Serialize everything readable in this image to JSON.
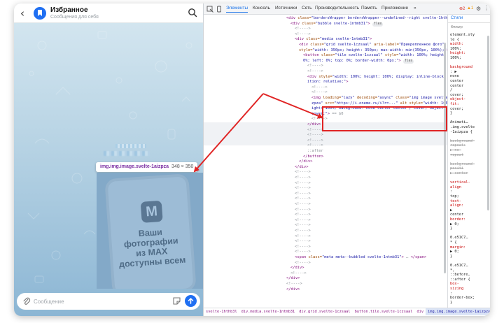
{
  "chat": {
    "back_icon": "arrow-left-icon",
    "title": "Избранное",
    "subtitle": "Сообщения для себя",
    "avatar_icon": "bookmark-icon",
    "search_icon": "search-icon",
    "tooltip": {
      "selector": "img.img.image.svelte-1aizpza",
      "size": "348 × 350"
    },
    "photo": {
      "logo": "M",
      "caption": [
        "Ваши",
        "фотографии",
        "из MAX",
        "доступны всем"
      ]
    },
    "composer": {
      "placeholder": "Сообщение",
      "attach_icon": "paperclip-icon",
      "sticker_icon": "sticker-icon",
      "send_icon": "send-arrow-icon"
    }
  },
  "devtools": {
    "tabs": [
      "Элементы",
      "Консоль",
      "Источники",
      "Сеть",
      "Производительность",
      "Память",
      "Приложение"
    ],
    "active_tab": "Элементы",
    "errors": "2",
    "warnings": "1",
    "more_tabs": "»",
    "code_lines": [
      {
        "indent": 0,
        "parts": [
          [
            "c-tag",
            "<div "
          ],
          [
            "c-attr",
            "class="
          ],
          [
            "c-val",
            "\"bordersWrapper bordersWrapper--undefined--right svelte-1hthb3l\""
          ],
          [
            "c-tag",
            ">"
          ],
          [
            "c-pill",
            "flex"
          ]
        ]
      },
      {
        "indent": 1,
        "parts": [
          [
            "c-tag",
            "<div "
          ],
          [
            "c-attr",
            "class="
          ],
          [
            "c-val",
            "\"bubble svelte-1ntmb31\""
          ],
          [
            "c-tag",
            "> "
          ],
          [
            "c-pill",
            "flex"
          ]
        ]
      },
      {
        "indent": 2,
        "parts": [
          [
            "c-dim",
            "<!---->"
          ]
        ]
      },
      {
        "indent": 2,
        "parts": [
          [
            "c-dim",
            "<!---->"
          ]
        ]
      },
      {
        "indent": 2,
        "parts": [
          [
            "c-tag",
            "<div "
          ],
          [
            "c-attr",
            "class="
          ],
          [
            "c-val",
            "\"media svelte-1ntmb31\""
          ],
          [
            "c-tag",
            ">"
          ]
        ]
      },
      {
        "indent": 3,
        "parts": [
          [
            "c-tag",
            "<div "
          ],
          [
            "c-attr",
            "class="
          ],
          [
            "c-val",
            "\"grid svelte-1czsaal\" "
          ],
          [
            "c-attr",
            "aria-label="
          ],
          [
            "c-val",
            "\"Прикрепленное фото\""
          ]
        ]
      },
      {
        "indent": 3,
        "parts": [
          [
            "c-attr",
            "style="
          ],
          [
            "c-val",
            "\"width: 350px; height: 350px; max-width: min(350px, 100%);\""
          ],
          [
            "c-tag",
            "> "
          ],
          [
            "c-pill",
            "grid"
          ]
        ]
      },
      {
        "indent": 4,
        "parts": [
          [
            "c-tag",
            "<button "
          ],
          [
            "c-attr",
            "class="
          ],
          [
            "c-val",
            "\"tile svelte-1czsaal\" "
          ],
          [
            "c-attr",
            "style="
          ],
          [
            "c-val",
            "\"width: 100%; height: 10"
          ]
        ]
      },
      {
        "indent": 4,
        "parts": [
          [
            "c-val",
            "0%; left: 0%; top: 0%; border-width: 0px;\""
          ],
          [
            "c-tag",
            "> "
          ],
          [
            "c-pill",
            "flex"
          ]
        ]
      },
      {
        "indent": 5,
        "parts": [
          [
            "c-dim",
            "<!---->"
          ]
        ]
      },
      {
        "indent": 5,
        "parts": [
          [
            "c-dim",
            "<!---->"
          ]
        ]
      },
      {
        "indent": 5,
        "parts": [
          [
            "c-tag",
            "<div "
          ],
          [
            "c-attr",
            "style="
          ],
          [
            "c-val",
            "\"width: 100%; height: 100%; display: inline-block; pos"
          ]
        ]
      },
      {
        "indent": 5,
        "parts": [
          [
            "c-val",
            "ition: relative;\""
          ],
          [
            "c-tag",
            ">"
          ]
        ]
      },
      {
        "indent": 6,
        "parts": [
          [
            "c-dim",
            "<!---->"
          ]
        ]
      },
      {
        "indent": 6,
        "parts": [
          [
            "c-dim",
            "<!---->"
          ]
        ]
      },
      {
        "indent": 6,
        "parts": [
          [
            "c-tag",
            "<img "
          ],
          [
            "c-attr",
            "loading="
          ],
          [
            "c-val",
            "\"lazy\" "
          ],
          [
            "c-attr",
            "decoding="
          ],
          [
            "c-val",
            "\"async\" "
          ],
          [
            "c-attr",
            "class="
          ],
          [
            "c-val",
            "\"img image svelte-1ai"
          ]
        ]
      },
      {
        "indent": 6,
        "parts": [
          [
            "c-val",
            "zpza\" "
          ],
          [
            "c-attr",
            "src="
          ],
          [
            "c-val",
            "\"https://i.oneme.ru/i?r=...\" "
          ],
          [
            "c-attr",
            "alt style="
          ],
          [
            "c-val",
            "\"width: 100%; he"
          ]
        ]
      },
      {
        "indent": 6,
        "parts": [
          [
            "c-val",
            "ight: 100%; background: none center center / cover; object-fit:"
          ]
        ]
      },
      {
        "indent": 6,
        "parts": [
          [
            "c-val",
            "cover;\""
          ],
          [
            "c-tag",
            "> "
          ],
          [
            "c-dim",
            "== $0"
          ]
        ]
      },
      {
        "indent": 6,
        "parts": [
          [
            "c-dim",
            "<!---->"
          ]
        ]
      },
      {
        "indent": 5,
        "parts": [
          [
            "c-tag",
            "</div>"
          ]
        ]
      },
      {
        "indent": 5,
        "parts": [
          [
            "c-dim",
            "<!---->"
          ]
        ]
      },
      {
        "indent": 5,
        "parts": [
          [
            "c-dim",
            "<!---->"
          ]
        ]
      },
      {
        "indent": 5,
        "parts": [
          [
            "c-dim",
            "<!---->"
          ]
        ]
      },
      {
        "indent": 5,
        "parts": [
          [
            "c-dim",
            "<!---->"
          ]
        ]
      },
      {
        "indent": 5,
        "parts": [
          [
            "c-dim",
            "::after"
          ]
        ]
      },
      {
        "indent": 4,
        "parts": [
          [
            "c-tag",
            "</button>"
          ]
        ]
      },
      {
        "indent": 3,
        "parts": [
          [
            "c-tag",
            "</div>"
          ]
        ]
      },
      {
        "indent": 2,
        "parts": [
          [
            "c-tag",
            "</div>"
          ]
        ]
      },
      {
        "indent": 2,
        "parts": [
          [
            "c-dim",
            "<!---->"
          ]
        ]
      },
      {
        "indent": 2,
        "parts": [
          [
            "c-dim",
            "<!---->"
          ]
        ]
      },
      {
        "indent": 2,
        "parts": [
          [
            "c-dim",
            "<!---->"
          ]
        ]
      },
      {
        "indent": 2,
        "parts": [
          [
            "c-dim",
            "<!---->"
          ]
        ]
      },
      {
        "indent": 2,
        "parts": [
          [
            "c-dim",
            "<!---->"
          ]
        ]
      },
      {
        "indent": 2,
        "parts": [
          [
            "c-dim",
            "<!---->"
          ]
        ]
      },
      {
        "indent": 2,
        "parts": [
          [
            "c-dim",
            "<!---->"
          ]
        ]
      },
      {
        "indent": 2,
        "parts": [
          [
            "c-dim",
            "<!---->"
          ]
        ]
      },
      {
        "indent": 2,
        "parts": [
          [
            "c-dim",
            "<!---->"
          ]
        ]
      },
      {
        "indent": 2,
        "parts": [
          [
            "c-dim",
            "<!---->"
          ]
        ]
      },
      {
        "indent": 2,
        "parts": [
          [
            "c-dim",
            "<!---->"
          ]
        ]
      },
      {
        "indent": 2,
        "parts": [
          [
            "c-dim",
            "<!---->"
          ]
        ]
      },
      {
        "indent": 2,
        "parts": [
          [
            "c-dim",
            "<!---->"
          ]
        ]
      },
      {
        "indent": 2,
        "parts": [
          [
            "c-dim",
            "<!---->"
          ]
        ]
      },
      {
        "indent": 2,
        "parts": [
          [
            "c-dim",
            "<!---->"
          ]
        ]
      },
      {
        "indent": 2,
        "parts": [
          [
            "c-dim",
            "<!---->"
          ]
        ]
      },
      {
        "indent": 2,
        "parts": [
          [
            "c-tag",
            "<span "
          ],
          [
            "c-attr",
            "class="
          ],
          [
            "c-val",
            "\"meta meta--bubbled svelte-1ntmb31\""
          ],
          [
            "c-tag",
            "> "
          ],
          [
            "c-dim",
            "… "
          ],
          [
            "c-tag",
            "</span>"
          ]
        ]
      },
      {
        "indent": 2,
        "parts": [
          [
            "c-dim",
            "<!---->"
          ]
        ]
      },
      {
        "indent": 1,
        "parts": [
          [
            "c-tag",
            "</div>"
          ]
        ]
      },
      {
        "indent": 1,
        "parts": [
          [
            "c-dim",
            "<!---->"
          ]
        ]
      },
      {
        "indent": 0,
        "parts": [
          [
            "c-tag",
            "</div>"
          ]
        ]
      },
      {
        "indent": 0,
        "parts": [
          [
            "c-dim",
            "<!---->"
          ]
        ]
      },
      {
        "indent": 0,
        "parts": [
          [
            "c-tag",
            "</div>"
          ]
        ]
      }
    ],
    "styles": {
      "tab_label": "Стили",
      "filter_placeholder": "Фильтр",
      "lines": [
        {
          "cls": "s-sel",
          "text": "element.sty"
        },
        {
          "cls": "s-sel",
          "text": "le {"
        },
        {
          "cls": "s-prop",
          "text": "  width:"
        },
        {
          "cls": "s-val",
          "text": "    100%;"
        },
        {
          "cls": "s-prop",
          "text": "  height:"
        },
        {
          "cls": "s-val",
          "text": "    100%;"
        },
        {
          "cls": "s-val",
          "text": ""
        },
        {
          "cls": "s-prop",
          "text": "background"
        },
        {
          "cls": "s-val",
          "text": "  : ▶"
        },
        {
          "cls": "s-val",
          "text": "    none"
        },
        {
          "cls": "s-val",
          "text": "    center"
        },
        {
          "cls": "s-val",
          "text": "    center"
        },
        {
          "cls": "s-val",
          "text": "    /"
        },
        {
          "cls": "s-val",
          "text": "    cover;"
        },
        {
          "cls": "s-prop",
          "text": "object-"
        },
        {
          "cls": "s-prop",
          "text": "  fit:"
        },
        {
          "cls": "s-val",
          "text": "    cover;"
        },
        {
          "cls": "s-sel",
          "text": "}"
        },
        {
          "cls": "s-val",
          "text": ""
        },
        {
          "cls": "s-sel",
          "text": " Animati…"
        },
        {
          "cls": "s-sel",
          "text": " .img.svelte"
        },
        {
          "cls": "s-sel",
          "text": " -1aizpza {"
        },
        {
          "cls": "s-val",
          "text": ""
        },
        {
          "cls": "s-strike",
          "text": "background-"
        },
        {
          "cls": "s-strike",
          "text": "  repeat:"
        },
        {
          "cls": "s-strike",
          "text": "  ▶ no-"
        },
        {
          "cls": "s-strike",
          "text": "  repeat"
        },
        {
          "cls": "s-val",
          "text": ""
        },
        {
          "cls": "s-strike",
          "text": "background-"
        },
        {
          "cls": "s-strike",
          "text": "  positi"
        },
        {
          "cls": "s-strike",
          "text": "  ▶ center"
        },
        {
          "cls": "s-val",
          "text": ""
        },
        {
          "cls": "s-prop",
          "text": "vertical-"
        },
        {
          "cls": "s-prop",
          "text": "  align"
        },
        {
          "cls": "s-val",
          "text": "    :"
        },
        {
          "cls": "s-val",
          "text": "    top;"
        },
        {
          "cls": "s-prop",
          "text": "  text-"
        },
        {
          "cls": "s-prop",
          "text": "  align:"
        },
        {
          "cls": "s-val",
          "text": "    ▶"
        },
        {
          "cls": "s-val",
          "text": "    center"
        },
        {
          "cls": "s-prop",
          "text": "  border:"
        },
        {
          "cls": "s-val",
          "text": "    ▶ 0;"
        },
        {
          "cls": "s-sel",
          "text": "}"
        },
        {
          "cls": "s-val",
          "text": ""
        },
        {
          "cls": "s-sel",
          "text": " 0.e51C7…"
        },
        {
          "cls": "s-sel",
          "text": "* {"
        },
        {
          "cls": "s-prop",
          "text": "  margin:"
        },
        {
          "cls": "s-val",
          "text": "    ▶ 0;"
        },
        {
          "cls": "s-sel",
          "text": "}"
        },
        {
          "cls": "s-val",
          "text": ""
        },
        {
          "cls": "s-sel",
          "text": " 0.e51C7…"
        },
        {
          "cls": "s-sel",
          "text": "*,"
        },
        {
          "cls": "s-sel",
          "text": " ::before,"
        },
        {
          "cls": "s-sel",
          "text": " ::after {"
        },
        {
          "cls": "s-prop",
          "text": "  box-"
        },
        {
          "cls": "s-prop",
          "text": "  sizing"
        },
        {
          "cls": "s-val",
          "text": "    :"
        },
        {
          "cls": "s-val",
          "text": "    border-box;"
        },
        {
          "cls": "s-sel",
          "text": "}"
        }
      ]
    },
    "breadcrumbs": [
      "svelte-1hthb3l",
      "div.media.svelte-1ntmb31",
      "div.grid.svelte-1czsaal",
      "button.tile.svelte-1czsaal",
      "div",
      "img.img.image.svelte-1aizpza"
    ],
    "active_breadcrumb": "img.img.image.svelte-1aizpza"
  },
  "annotation": {
    "color": "#e02424"
  }
}
